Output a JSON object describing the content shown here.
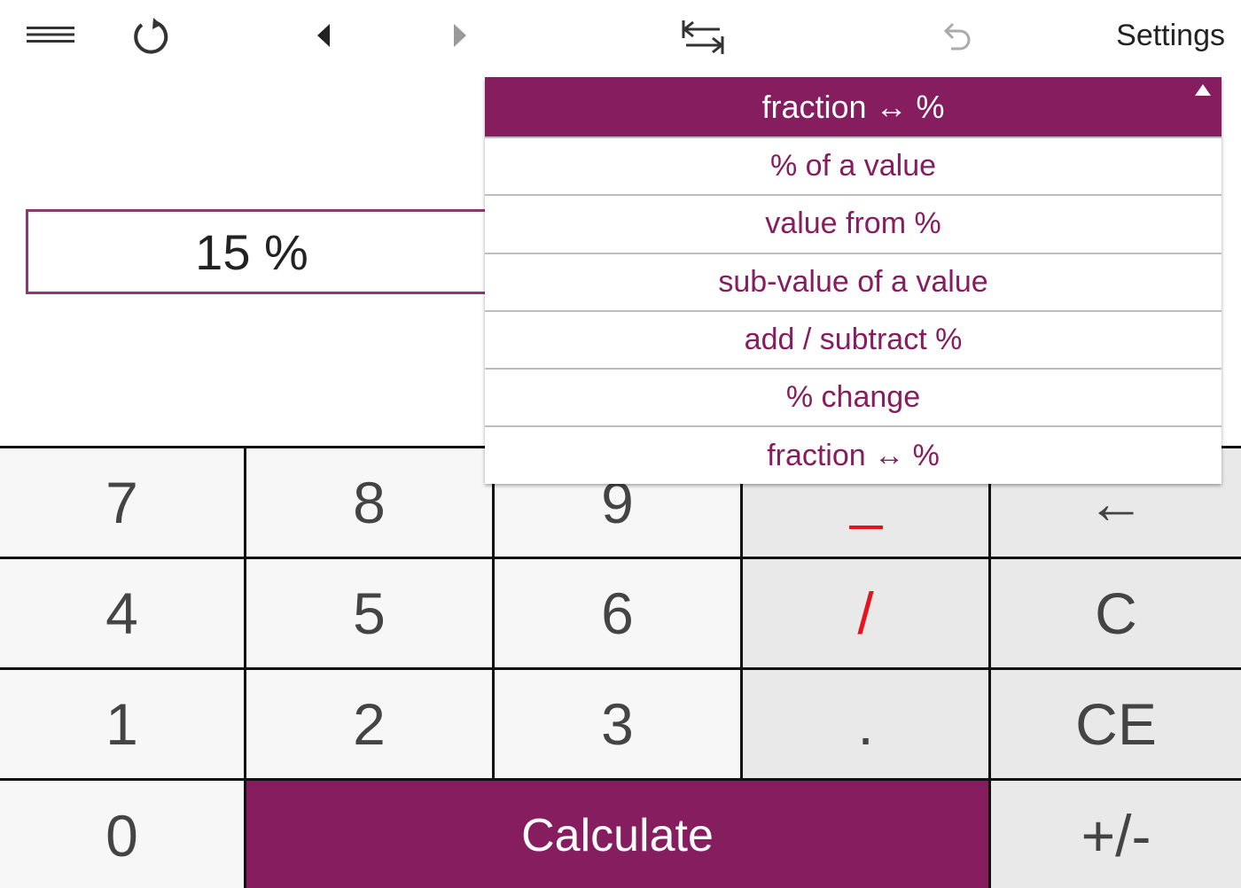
{
  "toolbar": {
    "settings_label": "Settings"
  },
  "display": {
    "value": "15 %"
  },
  "dropdown": {
    "selected": "fraction ↔ %",
    "items": [
      "% of a value",
      "value from %",
      "sub-value of a value",
      "add / subtract %",
      "% change",
      "fraction ↔ %"
    ]
  },
  "keypad": {
    "row1": [
      "7",
      "8",
      "9",
      "",
      "←"
    ],
    "row2": [
      "4",
      "5",
      "6",
      "/",
      "C"
    ],
    "row3": [
      "1",
      "2",
      "3",
      ".",
      "CE"
    ],
    "row4": {
      "zero": "0",
      "calculate": "Calculate",
      "sign": "+/-"
    }
  },
  "colors": {
    "accent": "#861d5e",
    "operator": "#e8131a"
  }
}
